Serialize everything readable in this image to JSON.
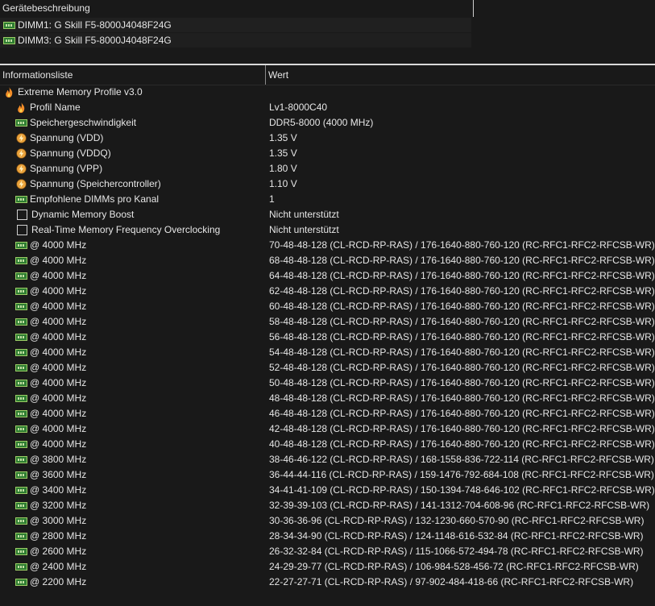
{
  "device_panel": {
    "header": "Gerätebeschreibung",
    "devices": [
      {
        "label": "DIMM1: G Skill F5-8000J4048F24G",
        "icon": "ram-icon"
      },
      {
        "label": "DIMM3: G Skill F5-8000J4048F24G",
        "icon": "ram-icon"
      }
    ]
  },
  "list": {
    "columns": {
      "info": "Informationsliste",
      "value": "Wert"
    },
    "group": {
      "label": "Extreme Memory Profile v3.0",
      "icon": "flame-icon"
    },
    "items": [
      {
        "label": "Profil Name",
        "value": "Lv1-8000C40",
        "icon": "flame-icon"
      },
      {
        "label": "Speichergeschwindigkeit",
        "value": "DDR5-8000 (4000 MHz)",
        "icon": "ram-icon"
      },
      {
        "label": "Spannung (VDD)",
        "value": "1.35 V",
        "icon": "voltage-icon"
      },
      {
        "label": "Spannung (VDDQ)",
        "value": "1.35 V",
        "icon": "voltage-icon"
      },
      {
        "label": "Spannung (VPP)",
        "value": "1.80 V",
        "icon": "voltage-icon"
      },
      {
        "label": "Spannung (Speichercontroller)",
        "value": "1.10 V",
        "icon": "voltage-icon"
      },
      {
        "label": "Empfohlene DIMMs pro Kanal",
        "value": "1",
        "icon": "ram-icon"
      },
      {
        "label": "Dynamic Memory Boost",
        "value": "Nicht unterstützt",
        "icon": "checkbox-icon"
      },
      {
        "label": "Real-Time Memory Frequency Overclocking",
        "value": "Nicht unterstützt",
        "icon": "checkbox-icon"
      },
      {
        "label": "@ 4000 MHz",
        "value": "70-48-48-128  (CL-RCD-RP-RAS) / 176-1640-880-760-120  (RC-RFC1-RFC2-RFCSB-WR)",
        "icon": "ram-icon"
      },
      {
        "label": "@ 4000 MHz",
        "value": "68-48-48-128  (CL-RCD-RP-RAS) / 176-1640-880-760-120  (RC-RFC1-RFC2-RFCSB-WR)",
        "icon": "ram-icon"
      },
      {
        "label": "@ 4000 MHz",
        "value": "64-48-48-128  (CL-RCD-RP-RAS) / 176-1640-880-760-120  (RC-RFC1-RFC2-RFCSB-WR)",
        "icon": "ram-icon"
      },
      {
        "label": "@ 4000 MHz",
        "value": "62-48-48-128  (CL-RCD-RP-RAS) / 176-1640-880-760-120  (RC-RFC1-RFC2-RFCSB-WR)",
        "icon": "ram-icon"
      },
      {
        "label": "@ 4000 MHz",
        "value": "60-48-48-128  (CL-RCD-RP-RAS) / 176-1640-880-760-120  (RC-RFC1-RFC2-RFCSB-WR)",
        "icon": "ram-icon"
      },
      {
        "label": "@ 4000 MHz",
        "value": "58-48-48-128  (CL-RCD-RP-RAS) / 176-1640-880-760-120  (RC-RFC1-RFC2-RFCSB-WR)",
        "icon": "ram-icon"
      },
      {
        "label": "@ 4000 MHz",
        "value": "56-48-48-128  (CL-RCD-RP-RAS) / 176-1640-880-760-120  (RC-RFC1-RFC2-RFCSB-WR)",
        "icon": "ram-icon"
      },
      {
        "label": "@ 4000 MHz",
        "value": "54-48-48-128  (CL-RCD-RP-RAS) / 176-1640-880-760-120  (RC-RFC1-RFC2-RFCSB-WR)",
        "icon": "ram-icon"
      },
      {
        "label": "@ 4000 MHz",
        "value": "52-48-48-128  (CL-RCD-RP-RAS) / 176-1640-880-760-120  (RC-RFC1-RFC2-RFCSB-WR)",
        "icon": "ram-icon"
      },
      {
        "label": "@ 4000 MHz",
        "value": "50-48-48-128  (CL-RCD-RP-RAS) / 176-1640-880-760-120  (RC-RFC1-RFC2-RFCSB-WR)",
        "icon": "ram-icon"
      },
      {
        "label": "@ 4000 MHz",
        "value": "48-48-48-128  (CL-RCD-RP-RAS) / 176-1640-880-760-120  (RC-RFC1-RFC2-RFCSB-WR)",
        "icon": "ram-icon"
      },
      {
        "label": "@ 4000 MHz",
        "value": "46-48-48-128  (CL-RCD-RP-RAS) / 176-1640-880-760-120  (RC-RFC1-RFC2-RFCSB-WR)",
        "icon": "ram-icon"
      },
      {
        "label": "@ 4000 MHz",
        "value": "42-48-48-128  (CL-RCD-RP-RAS) / 176-1640-880-760-120  (RC-RFC1-RFC2-RFCSB-WR)",
        "icon": "ram-icon"
      },
      {
        "label": "@ 4000 MHz",
        "value": "40-48-48-128  (CL-RCD-RP-RAS) / 176-1640-880-760-120  (RC-RFC1-RFC2-RFCSB-WR)",
        "icon": "ram-icon"
      },
      {
        "label": "@ 3800 MHz",
        "value": "38-46-46-122  (CL-RCD-RP-RAS) / 168-1558-836-722-114  (RC-RFC1-RFC2-RFCSB-WR)",
        "icon": "ram-icon"
      },
      {
        "label": "@ 3600 MHz",
        "value": "36-44-44-116  (CL-RCD-RP-RAS) / 159-1476-792-684-108  (RC-RFC1-RFC2-RFCSB-WR)",
        "icon": "ram-icon"
      },
      {
        "label": "@ 3400 MHz",
        "value": "34-41-41-109  (CL-RCD-RP-RAS) / 150-1394-748-646-102  (RC-RFC1-RFC2-RFCSB-WR)",
        "icon": "ram-icon"
      },
      {
        "label": "@ 3200 MHz",
        "value": "32-39-39-103  (CL-RCD-RP-RAS) / 141-1312-704-608-96  (RC-RFC1-RFC2-RFCSB-WR)",
        "icon": "ram-icon"
      },
      {
        "label": "@ 3000 MHz",
        "value": "30-36-36-96  (CL-RCD-RP-RAS) / 132-1230-660-570-90  (RC-RFC1-RFC2-RFCSB-WR)",
        "icon": "ram-icon"
      },
      {
        "label": "@ 2800 MHz",
        "value": "28-34-34-90  (CL-RCD-RP-RAS) / 124-1148-616-532-84  (RC-RFC1-RFC2-RFCSB-WR)",
        "icon": "ram-icon"
      },
      {
        "label": "@ 2600 MHz",
        "value": "26-32-32-84  (CL-RCD-RP-RAS) / 115-1066-572-494-78  (RC-RFC1-RFC2-RFCSB-WR)",
        "icon": "ram-icon"
      },
      {
        "label": "@ 2400 MHz",
        "value": "24-29-29-77  (CL-RCD-RP-RAS) / 106-984-528-456-72  (RC-RFC1-RFC2-RFCSB-WR)",
        "icon": "ram-icon"
      },
      {
        "label": "@ 2200 MHz",
        "value": "22-27-27-71  (CL-RCD-RP-RAS) / 97-902-484-418-66  (RC-RFC1-RFC2-RFCSB-WR)",
        "icon": "ram-icon"
      }
    ]
  }
}
